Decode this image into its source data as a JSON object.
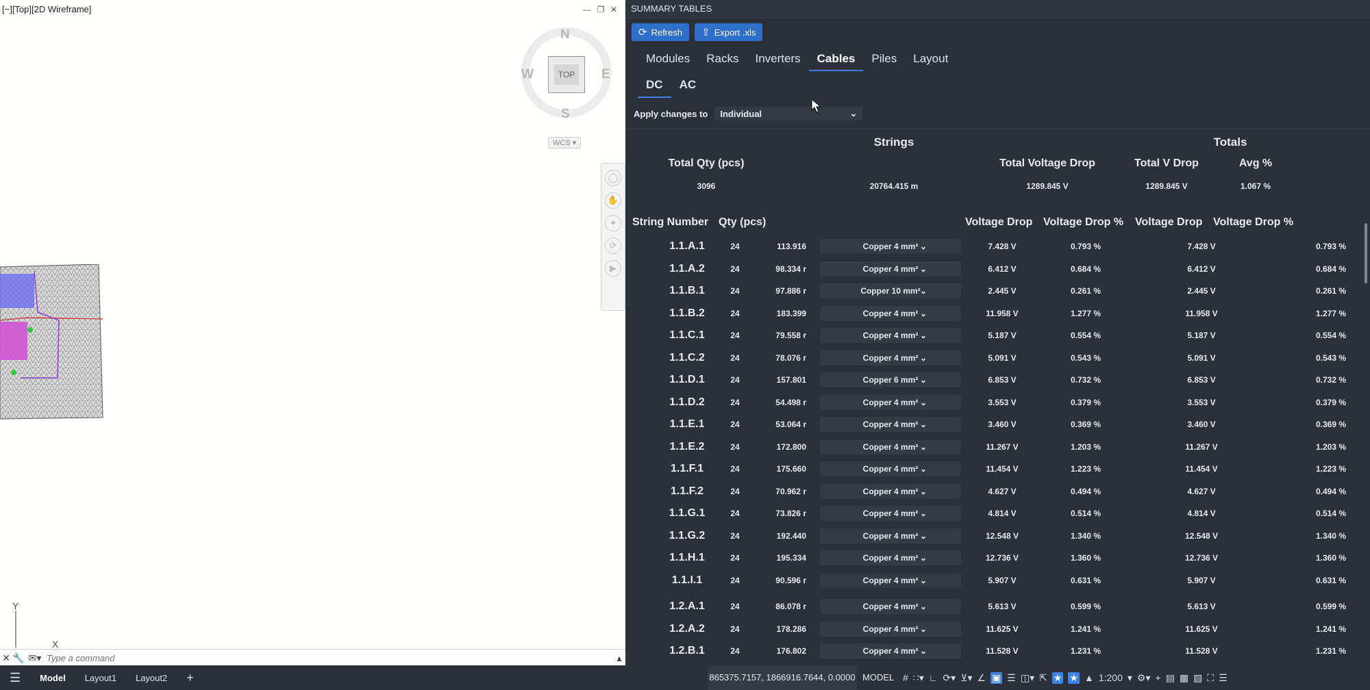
{
  "viewport": {
    "label": "[−][Top][2D Wireframe]",
    "viewcube": {
      "north": "N",
      "south": "S",
      "east": "E",
      "west": "W",
      "face": "TOP",
      "ucs": "WCS"
    },
    "ucs_axis_y": "Y",
    "ucs_axis_x": "X"
  },
  "command_line": {
    "placeholder": "Type a command"
  },
  "panel": {
    "title": "SUMMARY TABLES",
    "buttons": {
      "refresh": "Refresh",
      "export": "Export .xls"
    },
    "tabs": [
      "Modules",
      "Racks",
      "Inverters",
      "Cables",
      "Piles",
      "Layout"
    ],
    "active_tab": "Cables",
    "subtabs": [
      "DC",
      "AC"
    ],
    "active_subtab": "DC",
    "apply_label": "Apply changes to",
    "apply_value": "Individual",
    "groups": {
      "strings": "Strings",
      "totals": "Totals"
    },
    "summary_headers": {
      "total_qty": "Total Qty (pcs)",
      "total_voltage_drop": "Total Voltage Drop",
      "total_v_drop": "Total V Drop",
      "avg_pct": "Avg %"
    },
    "summary_values": {
      "total_qty": "3096",
      "total_length": "20764.415 m",
      "total_voltage_drop": "1289.845 V",
      "total_v_drop": "1289.845 V",
      "avg_pct": "1.067 %"
    },
    "columns": {
      "string_number": "String Number",
      "qty": "Qty (pcs)",
      "voltage_drop": "Voltage Drop",
      "voltage_drop_pct": "Voltage Drop %",
      "total_voltage_drop": "Voltage Drop",
      "total_voltage_drop_pct": "Voltage Drop %"
    },
    "rows": [
      {
        "sn": "1.1.A.1",
        "qty": "24",
        "len": "113.916",
        "cable": "Copper 4 mm²",
        "vd": "7.428 V",
        "vdp": "0.793 %",
        "tvd": "7.428 V",
        "tvdp": "0.793 %"
      },
      {
        "sn": "1.1.A.2",
        "qty": "24",
        "len": "98.334 r",
        "cable": "Copper 4 mm²",
        "vd": "6.412 V",
        "vdp": "0.684 %",
        "tvd": "6.412 V",
        "tvdp": "0.684 %"
      },
      {
        "sn": "1.1.B.1",
        "qty": "24",
        "len": "97.886 r",
        "cable": "Copper 10 mm²",
        "vd": "2.445 V",
        "vdp": "0.261 %",
        "tvd": "2.445 V",
        "tvdp": "0.261 %"
      },
      {
        "sn": "1.1.B.2",
        "qty": "24",
        "len": "183.399",
        "cable": "Copper 4 mm²",
        "vd": "11.958 V",
        "vdp": "1.277 %",
        "tvd": "11.958 V",
        "tvdp": "1.277 %"
      },
      {
        "sn": "1.1.C.1",
        "qty": "24",
        "len": "79.558 r",
        "cable": "Copper 4 mm²",
        "vd": "5.187 V",
        "vdp": "0.554 %",
        "tvd": "5.187 V",
        "tvdp": "0.554 %"
      },
      {
        "sn": "1.1.C.2",
        "qty": "24",
        "len": "78.076 r",
        "cable": "Copper 4 mm²",
        "vd": "5.091 V",
        "vdp": "0.543 %",
        "tvd": "5.091 V",
        "tvdp": "0.543 %"
      },
      {
        "sn": "1.1.D.1",
        "qty": "24",
        "len": "157.801",
        "cable": "Copper 6 mm²",
        "vd": "6.853 V",
        "vdp": "0.732 %",
        "tvd": "6.853 V",
        "tvdp": "0.732 %"
      },
      {
        "sn": "1.1.D.2",
        "qty": "24",
        "len": "54.498 r",
        "cable": "Copper 4 mm²",
        "vd": "3.553 V",
        "vdp": "0.379 %",
        "tvd": "3.553 V",
        "tvdp": "0.379 %"
      },
      {
        "sn": "1.1.E.1",
        "qty": "24",
        "len": "53.064 r",
        "cable": "Copper 4 mm²",
        "vd": "3.460 V",
        "vdp": "0.369 %",
        "tvd": "3.460 V",
        "tvdp": "0.369 %"
      },
      {
        "sn": "1.1.E.2",
        "qty": "24",
        "len": "172.800",
        "cable": "Copper 4 mm²",
        "vd": "11.267 V",
        "vdp": "1.203 %",
        "tvd": "11.267 V",
        "tvdp": "1.203 %"
      },
      {
        "sn": "1.1.F.1",
        "qty": "24",
        "len": "175.660",
        "cable": "Copper 4 mm²",
        "vd": "11.454 V",
        "vdp": "1.223 %",
        "tvd": "11.454 V",
        "tvdp": "1.223 %"
      },
      {
        "sn": "1.1.F.2",
        "qty": "24",
        "len": "70.962 r",
        "cable": "Copper 4 mm²",
        "vd": "4.627 V",
        "vdp": "0.494 %",
        "tvd": "4.627 V",
        "tvdp": "0.494 %"
      },
      {
        "sn": "1.1.G.1",
        "qty": "24",
        "len": "73.826 r",
        "cable": "Copper 4 mm²",
        "vd": "4.814 V",
        "vdp": "0.514 %",
        "tvd": "4.814 V",
        "tvdp": "0.514 %"
      },
      {
        "sn": "1.1.G.2",
        "qty": "24",
        "len": "192.440",
        "cable": "Copper 4 mm²",
        "vd": "12.548 V",
        "vdp": "1.340 %",
        "tvd": "12.548 V",
        "tvdp": "1.340 %"
      },
      {
        "sn": "1.1.H.1",
        "qty": "24",
        "len": "195.334",
        "cable": "Copper 4 mm²",
        "vd": "12.736 V",
        "vdp": "1.360 %",
        "tvd": "12.736 V",
        "tvdp": "1.360 %"
      },
      {
        "sn": "1.1.I.1",
        "qty": "24",
        "len": "90.596 r",
        "cable": "Copper 4 mm²",
        "vd": "5.907 V",
        "vdp": "0.631 %",
        "tvd": "5.907 V",
        "tvdp": "0.631 %"
      },
      {
        "sn": "1.2.A.1",
        "qty": "24",
        "len": "86.078 r",
        "cable": "Copper 4 mm²",
        "vd": "5.613 V",
        "vdp": "0.599 %",
        "tvd": "5.613 V",
        "tvdp": "0.599 %"
      },
      {
        "sn": "1.2.A.2",
        "qty": "24",
        "len": "178.286",
        "cable": "Copper 4 mm²",
        "vd": "11.625 V",
        "vdp": "1.241 %",
        "tvd": "11.625 V",
        "tvdp": "1.241 %"
      },
      {
        "sn": "1.2.B.1",
        "qty": "24",
        "len": "176.802",
        "cable": "Copper 4 mm²",
        "vd": "11.528 V",
        "vdp": "1.231 %",
        "tvd": "11.528 V",
        "tvdp": "1.231 %"
      }
    ]
  },
  "statusbar": {
    "tabs": [
      "Model",
      "Layout1",
      "Layout2"
    ],
    "active_tab": "Model",
    "coords": "865375.7157, 1866916.7644, 0.0000",
    "space": "MODEL",
    "scale": "1:200"
  },
  "colors": {
    "panel_bg": "#2b3039",
    "accent": "#3d82e8",
    "button": "#2f6fcc"
  }
}
